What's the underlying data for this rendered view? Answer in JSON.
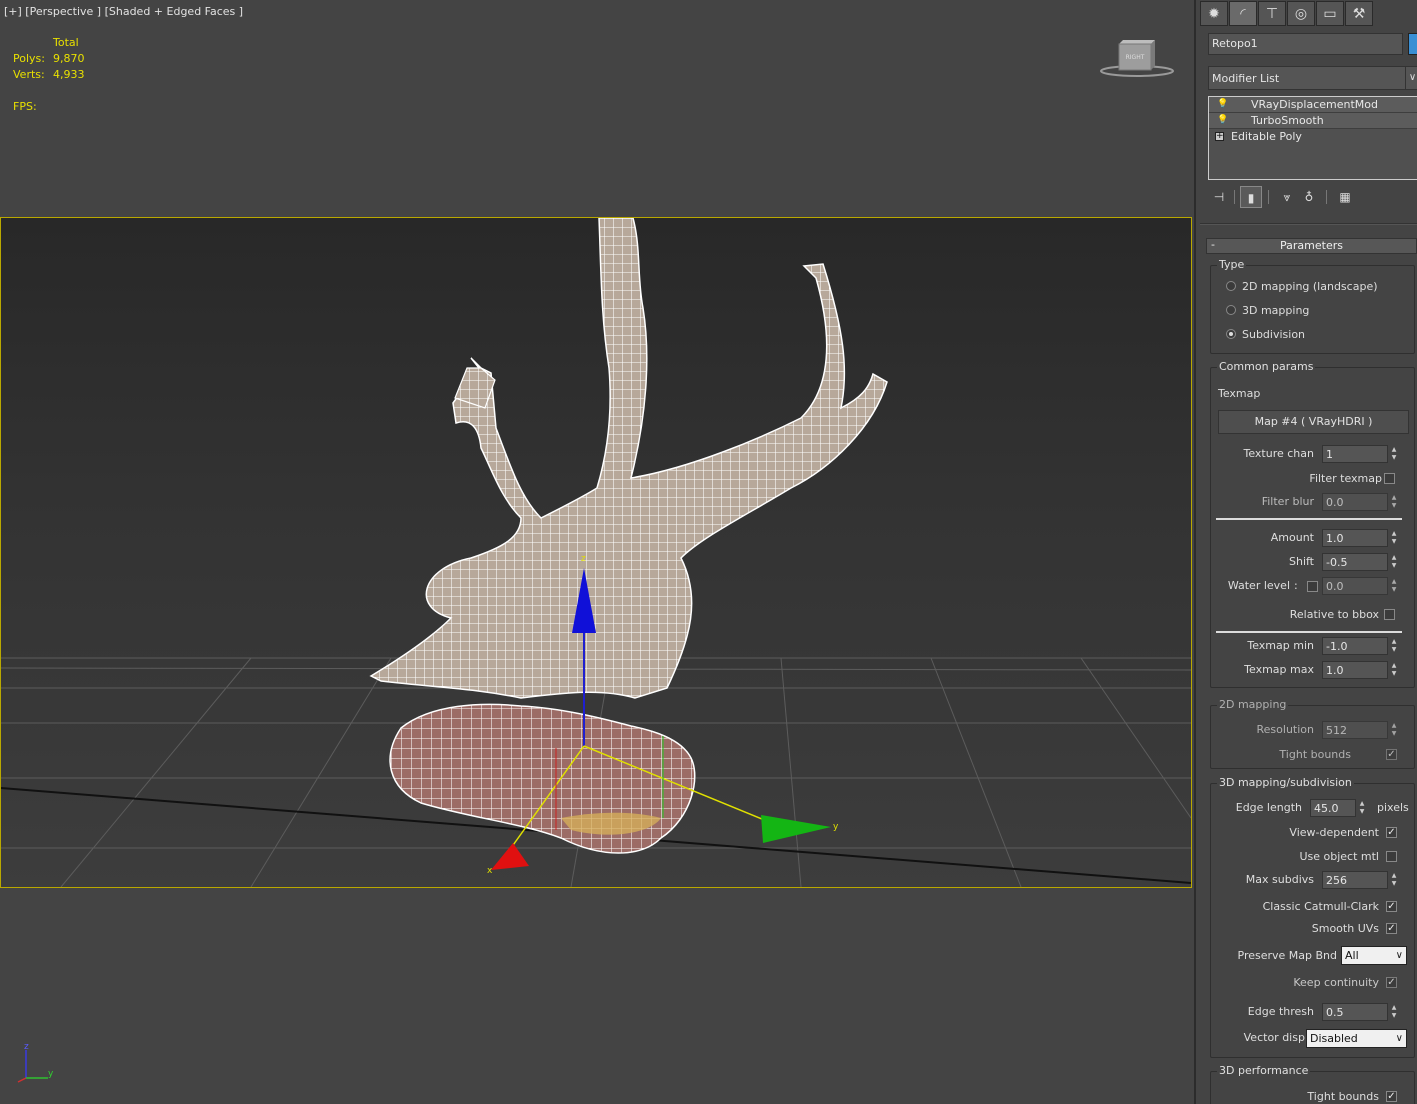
{
  "viewport": {
    "label": "[+] [Perspective ] [Shaded + Edged Faces ]",
    "stats": {
      "header": "Total",
      "polys_label": "Polys:",
      "polys_value": "9,870",
      "verts_label": "Verts:",
      "verts_value": "4,933",
      "fps_label": "FPS:"
    },
    "viewcube_label": "RIGHT",
    "gizmo_labels": {
      "x": "x",
      "y": "y",
      "z": "z"
    },
    "mini_axis_labels": {
      "z": "z",
      "y": "y"
    }
  },
  "panel": {
    "tabs": [
      {
        "name": "create",
        "glyph": "✹"
      },
      {
        "name": "modify",
        "glyph": "◜"
      },
      {
        "name": "hierarchy",
        "glyph": "⊤"
      },
      {
        "name": "motion",
        "glyph": "◎"
      },
      {
        "name": "display",
        "glyph": "▭"
      },
      {
        "name": "utilities",
        "glyph": "⚒"
      }
    ],
    "object_name": "Retopo1",
    "object_color": "#3a8fd4",
    "modifier_list": "Modifier List",
    "stack": [
      {
        "label": "VRayDisplacementMod",
        "icon": "bulb-icon"
      },
      {
        "label": "TurboSmooth",
        "icon": "bulb-icon"
      },
      {
        "label": "Editable Poly",
        "icon": "expand-icon"
      }
    ],
    "rollout_title": "Parameters",
    "type_group": {
      "title": "Type",
      "options": [
        "2D mapping (landscape)",
        "3D mapping",
        "Subdivision"
      ],
      "selected": "Subdivision"
    },
    "common": {
      "title": "Common params",
      "texmap_label": "Texmap",
      "texmap_button": "Map #4 ( VRayHDRI )",
      "texture_chan_label": "Texture chan",
      "texture_chan": "1",
      "filter_texmap_label": "Filter texmap",
      "filter_texmap": false,
      "filter_blur_label": "Filter blur",
      "filter_blur": "0.0",
      "amount_label": "Amount",
      "amount": "1.0",
      "shift_label": "Shift",
      "shift": "-0.5",
      "water_level_label": "Water level",
      "water_level_colon": ":",
      "water_level_enabled": false,
      "water_level": "0.0",
      "relative_label": "Relative to bbox",
      "relative": false,
      "texmap_min_label": "Texmap min",
      "texmap_min": "-1.0",
      "texmap_max_label": "Texmap max",
      "texmap_max": "1.0"
    },
    "mapping2d": {
      "title": "2D mapping",
      "resolution_label": "Resolution",
      "resolution": "512",
      "tight_bounds_label": "Tight bounds",
      "tight_bounds": true
    },
    "mapping3d": {
      "title": "3D mapping/subdivision",
      "edge_length_label": "Edge length",
      "edge_length": "45.0",
      "pixels_label": "pixels",
      "view_dependent_label": "View-dependent",
      "view_dependent": true,
      "use_object_mtl_label": "Use object mtl",
      "use_object_mtl": false,
      "max_subdivs_label": "Max subdivs",
      "max_subdivs": "256",
      "classic_label": "Classic Catmull-Clark",
      "classic": true,
      "smooth_uvs_label": "Smooth UVs",
      "smooth_uvs": true,
      "preserve_label": "Preserve Map Bnd",
      "preserve": "All",
      "keep_continuity_label": "Keep continuity",
      "keep_continuity": true,
      "edge_thresh_label": "Edge thresh",
      "edge_thresh": "0.5",
      "vector_displ_label": "Vector displ",
      "vector_displ": "Disabled"
    },
    "performance": {
      "title": "3D performance",
      "tight_bounds_label": "Tight bounds",
      "tight_bounds": true
    }
  }
}
